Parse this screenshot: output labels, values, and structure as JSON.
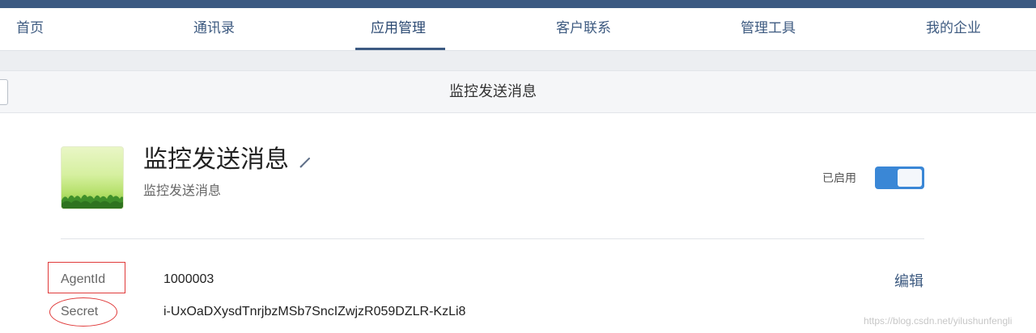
{
  "nav": {
    "items": [
      {
        "label": "首页"
      },
      {
        "label": "通讯录"
      },
      {
        "label": "应用管理",
        "active": true
      },
      {
        "label": "客户联系"
      },
      {
        "label": "管理工具"
      },
      {
        "label": "我的企业"
      }
    ]
  },
  "subheader": {
    "title": "监控发送消息"
  },
  "app": {
    "name": "监控发送消息",
    "description": "监控发送消息",
    "status_label": "已启用",
    "enabled": true
  },
  "fields": {
    "agentid_label": "AgentId",
    "agentid_value": "1000003",
    "secret_label": "Secret",
    "secret_value": "i-UxOaDXysdTnrjbzMSb7SncIZwjzR059DZLR-KzLi8",
    "edit_label": "编辑"
  },
  "watermark": "https://blog.csdn.net/yilushunfengli",
  "colors": {
    "nav_text": "#3d5a80",
    "topbar": "#3c5a82",
    "toggle_on": "#3a87d6",
    "annotation": "#e03a3a"
  },
  "icons": {
    "app_icon": "green-landscape-app-icon",
    "edit_name": "pencil-icon"
  }
}
